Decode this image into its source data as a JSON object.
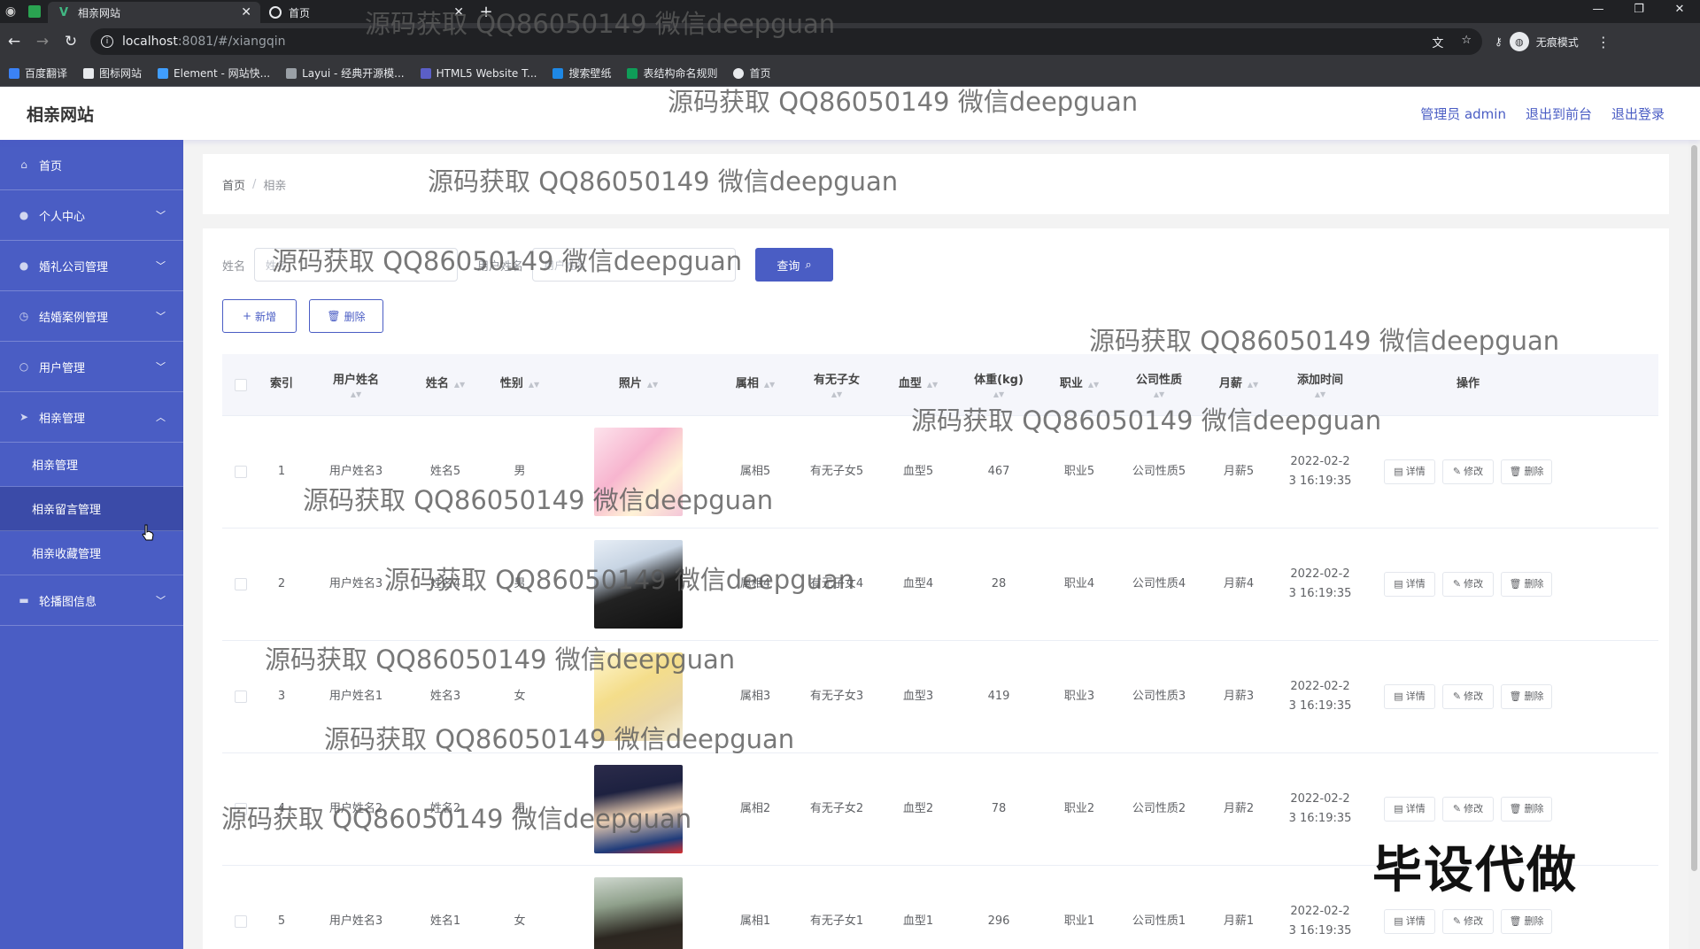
{
  "browser": {
    "tabs": [
      {
        "title": "相亲网站",
        "active": true
      },
      {
        "title": "首页",
        "active": false
      }
    ],
    "url_host": "localhost",
    "url_rest": ":8081/#/xiangqin",
    "incognito_label": "无痕模式",
    "bookmarks": [
      "百度翻译",
      "图标网站",
      "Element - 网站快...",
      "Layui - 经典开源模...",
      "HTML5 Website T...",
      "搜索壁纸",
      "表结构命名规则",
      "首页"
    ]
  },
  "header": {
    "title": "相亲网站",
    "links": [
      "管理员 admin",
      "退出到前台",
      "退出登录"
    ]
  },
  "sidebar": {
    "items": [
      {
        "label": "首页",
        "expandable": false
      },
      {
        "label": "个人中心",
        "expandable": true
      },
      {
        "label": "婚礼公司管理",
        "expandable": true
      },
      {
        "label": "结婚案例管理",
        "expandable": true
      },
      {
        "label": "用户管理",
        "expandable": true
      },
      {
        "label": "相亲管理",
        "expandable": true,
        "expanded": true
      }
    ],
    "sub_items": [
      "相亲管理",
      "相亲留言管理",
      "相亲收藏管理"
    ],
    "after": {
      "label": "轮播图信息",
      "expandable": true
    }
  },
  "breadcrumb": {
    "home": "首页",
    "current": "相亲"
  },
  "search": {
    "field1_label": "姓名",
    "field1_placeholder": "姓名",
    "field2_label": "用户姓名",
    "field2_placeholder": "用户姓名",
    "button_label": "查询"
  },
  "actions": {
    "add_label": "新增",
    "delete_label": "删除"
  },
  "table": {
    "headers": [
      "索引",
      "用户姓名",
      "姓名",
      "性别",
      "照片",
      "属相",
      "有无子女",
      "血型",
      "体重(kg)",
      "职业",
      "公司性质",
      "月薪",
      "添加时间",
      "操作"
    ],
    "op_labels": {
      "detail": "详情",
      "edit": "修改",
      "delete": "删除"
    },
    "rows": [
      {
        "index": "1",
        "username": "用户姓名3",
        "name": "姓名5",
        "gender": "男",
        "zodiac": "属相5",
        "children": "有无子女5",
        "blood": "血型5",
        "weight": "467",
        "job": "职业5",
        "company": "公司性质5",
        "salary": "月薪5",
        "time1": "2022-02-2",
        "time2": "3 16:19:35"
      },
      {
        "index": "2",
        "username": "用户姓名3",
        "name": "姓名4",
        "gender": "男",
        "zodiac": "属相4",
        "children": "有无子女4",
        "blood": "血型4",
        "weight": "28",
        "job": "职业4",
        "company": "公司性质4",
        "salary": "月薪4",
        "time1": "2022-02-2",
        "time2": "3 16:19:35"
      },
      {
        "index": "3",
        "username": "用户姓名1",
        "name": "姓名3",
        "gender": "女",
        "zodiac": "属相3",
        "children": "有无子女3",
        "blood": "血型3",
        "weight": "419",
        "job": "职业3",
        "company": "公司性质3",
        "salary": "月薪3",
        "time1": "2022-02-2",
        "time2": "3 16:19:35"
      },
      {
        "index": "4",
        "username": "用户姓名2",
        "name": "姓名2",
        "gender": "男",
        "zodiac": "属相2",
        "children": "有无子女2",
        "blood": "血型2",
        "weight": "78",
        "job": "职业2",
        "company": "公司性质2",
        "salary": "月薪2",
        "time1": "2022-02-2",
        "time2": "3 16:19:35"
      },
      {
        "index": "5",
        "username": "用户姓名3",
        "name": "姓名1",
        "gender": "女",
        "zodiac": "属相1",
        "children": "有无子女1",
        "blood": "血型1",
        "weight": "296",
        "job": "职业1",
        "company": "公司性质1",
        "salary": "月薪1",
        "time1": "2022-02-2",
        "time2": "3 16:19:35"
      }
    ]
  },
  "watermark": {
    "text": "源码获取 QQ86050149 微信deepguan",
    "big_text": "毕设代做"
  },
  "colors": {
    "primary": "#4a5dc4",
    "sidebar_active": "#3b4ba8"
  }
}
